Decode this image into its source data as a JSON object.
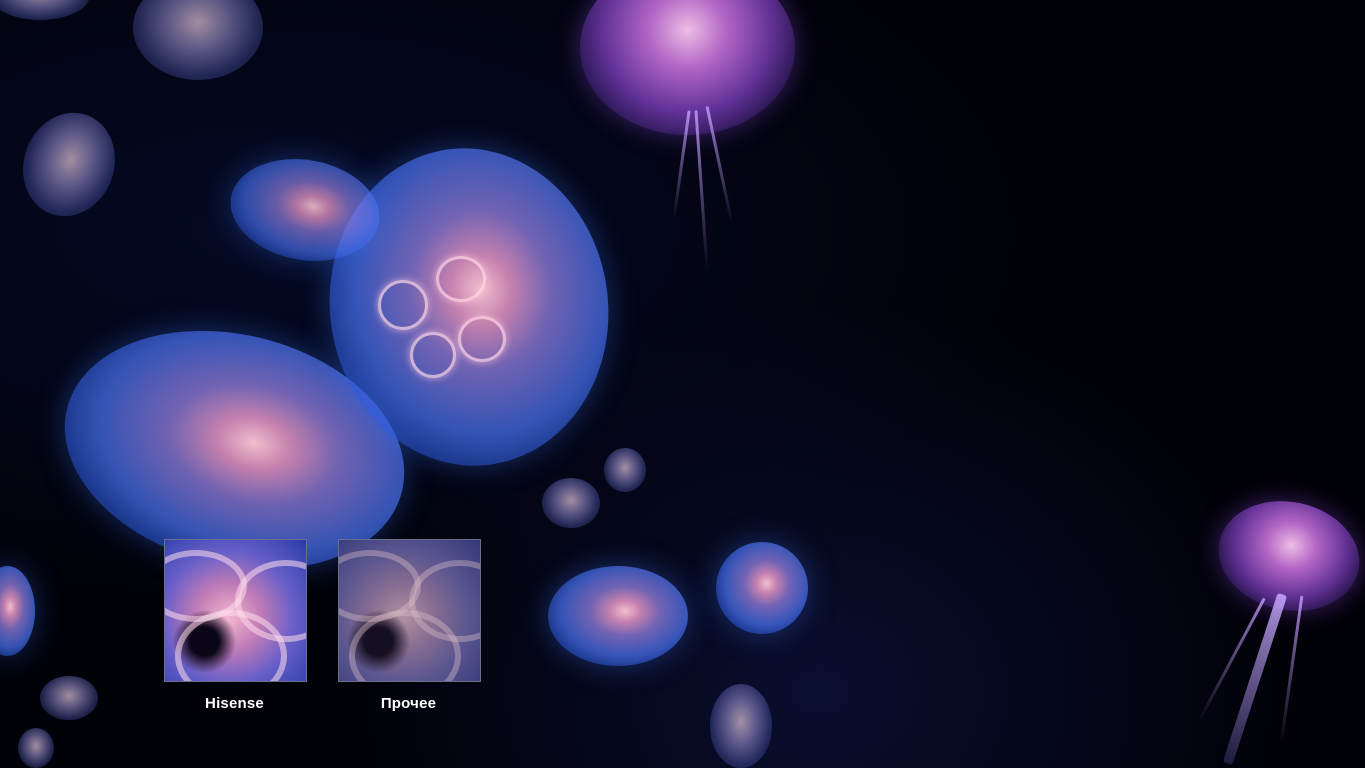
{
  "comparison": {
    "left_label": "Hisense",
    "right_label": "Прочее"
  }
}
